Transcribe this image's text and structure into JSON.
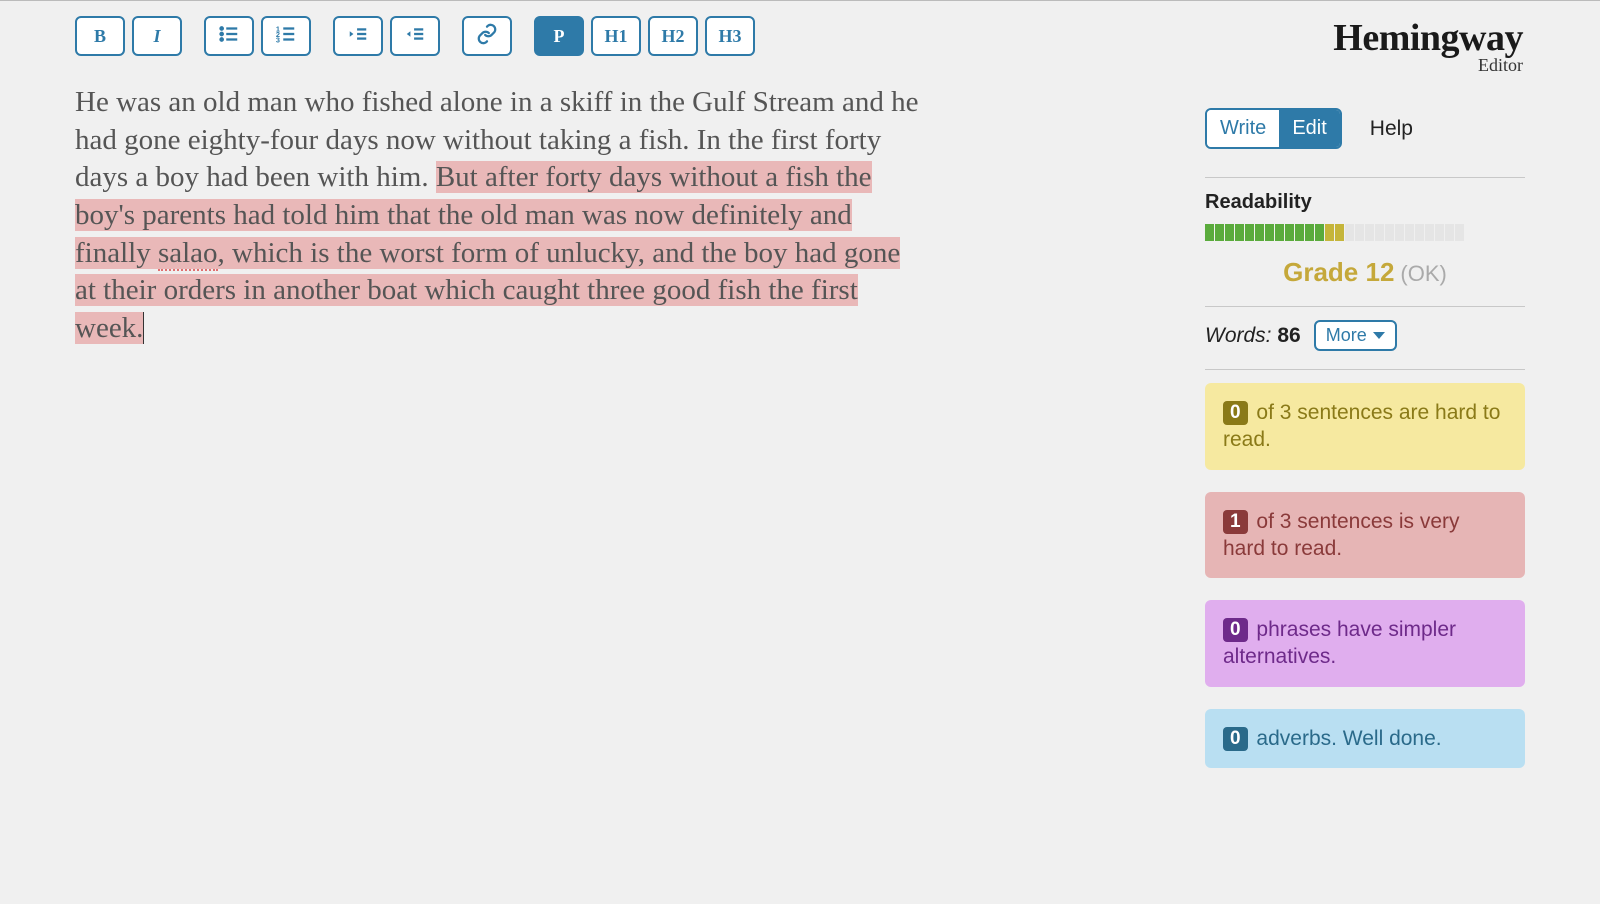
{
  "toolbar": {
    "bold": "B",
    "italic": "I",
    "p": "P",
    "h1": "H1",
    "h2": "H2",
    "h3": "H3"
  },
  "editor": {
    "text_plain": "He was an old man who fished alone in a skiff in the Gulf Stream and he had gone eighty-four days now without taking a fish. In the first forty days a boy had been with him. ",
    "text_highlighted_before_spell": "But after forty days without a fish the boy's parents had told him that the old man was now definitely and finally ",
    "spell_word": "salao",
    "text_highlighted_after_spell": ", which is the worst form of unlucky, and the boy had gone at their orders in another boat which caught three good fish the first week."
  },
  "sidebar": {
    "brand_name": "Hemingway",
    "brand_sub": "Editor",
    "mode_write": "Write",
    "mode_edit": "Edit",
    "help": "Help",
    "readability_label": "Readability",
    "grade": "Grade 12",
    "grade_ok": "(OK)",
    "words_label": "Words: ",
    "words_count": "86",
    "more": "More",
    "meter": {
      "total": 26,
      "green": 12,
      "yellow": 2
    },
    "cards": {
      "hard": {
        "count": "0",
        "text": " of 3 sentences are hard to read."
      },
      "veryhard": {
        "count": "1",
        "text": " of 3 sentences is very hard to read."
      },
      "simpler": {
        "count": "0",
        "text": " phrases have simpler alternatives."
      },
      "adverbs": {
        "count": "0",
        "text": " adverbs. Well done."
      }
    }
  }
}
